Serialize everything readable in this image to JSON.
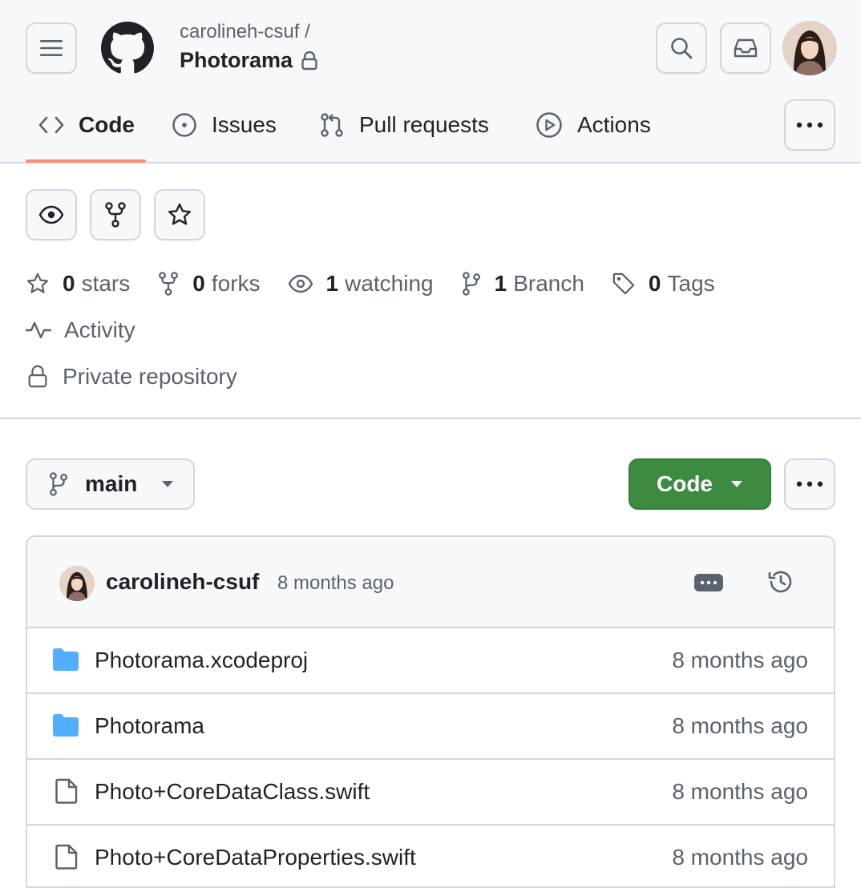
{
  "header": {
    "owner": "carolineh-csuf /",
    "repo": "Photorama"
  },
  "tabs": [
    {
      "label": "Code",
      "icon": "code-icon",
      "active": true
    },
    {
      "label": "Issues",
      "icon": "issue-opened-icon"
    },
    {
      "label": "Pull requests",
      "icon": "git-pull-request-icon"
    },
    {
      "label": "Actions",
      "icon": "play-icon"
    }
  ],
  "stats": {
    "stars_count": "0",
    "stars_label": "stars",
    "forks_count": "0",
    "forks_label": "forks",
    "watching_count": "1",
    "watching_label": "watching",
    "branch_count": "1",
    "branch_label": "Branch",
    "tags_count": "0",
    "tags_label": "Tags"
  },
  "activity_label": "Activity",
  "visibility_label": "Private repository",
  "branch": {
    "name": "main"
  },
  "code_button": {
    "label": "Code",
    "color": "#3d8b40"
  },
  "commit": {
    "author": "carolineh-csuf",
    "time": "8 months ago"
  },
  "files": [
    {
      "name": "Photorama.xcodeproj",
      "type": "folder",
      "date": "8 months ago"
    },
    {
      "name": "Photorama",
      "type": "folder",
      "date": "8 months ago"
    },
    {
      "name": "Photo+CoreDataClass.swift",
      "type": "file",
      "date": "8 months ago"
    },
    {
      "name": "Photo+CoreDataProperties.swift",
      "type": "file",
      "date": "8 months ago"
    }
  ],
  "colors": {
    "accent_underline": "#fd8c73",
    "folder": "#54aeff",
    "muted_text": "#59636e",
    "border": "#d0d7de"
  }
}
